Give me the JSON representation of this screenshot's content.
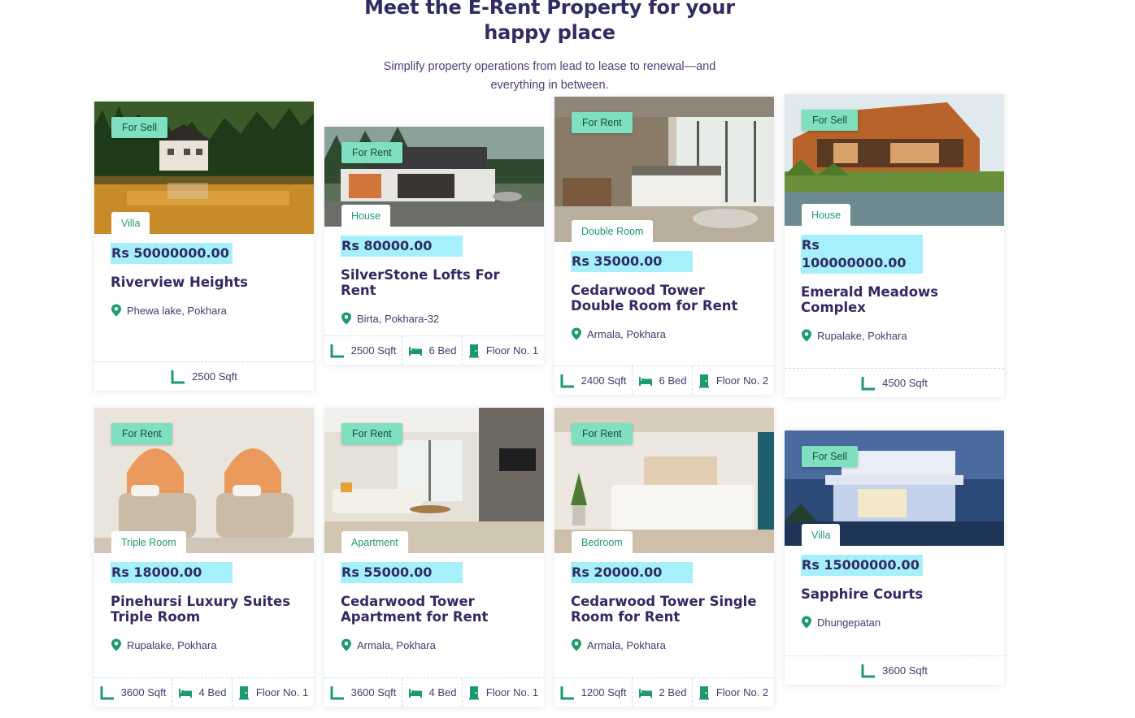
{
  "header": {
    "title_line1": "Meet the E-Rent Property for your",
    "title_line2": "happy place",
    "subtitle_line1": "Simplify property operations from lead to lease to renewal—and",
    "subtitle_line2": "everything in between."
  },
  "colors": {
    "accent": "#7fe0c0",
    "price_bg": "#a6f0fb",
    "heading": "#2f2c63",
    "green": "#1d9a6c"
  },
  "listings": [
    {
      "status": "For Sell",
      "type": "Villa",
      "price": "Rs 50000000.00",
      "title": "Riverview Heights",
      "location": "Phewa lake, Pokhara",
      "area": "2500 Sqft"
    },
    {
      "status": "For Rent",
      "type": "House",
      "price": "Rs 80000.00",
      "title": "SilverStone Lofts For Rent",
      "location": "Birta, Pokhara-32",
      "area": "2500 Sqft",
      "beds": "6 Bed",
      "floor": "Floor No. 1"
    },
    {
      "status": "For Rent",
      "type": "Double Room",
      "price": "Rs 35000.00",
      "title": "Cedarwood Tower Double Room for Rent",
      "location": "Armala, Pokhara",
      "area": "2400 Sqft",
      "beds": "6 Bed",
      "floor": "Floor No. 2"
    },
    {
      "status": "For Sell",
      "type": "House",
      "price": "Rs 100000000.00",
      "title": "Emerald Meadows Complex",
      "location": "Rupalake, Pokhara",
      "area": "4500 Sqft"
    },
    {
      "status": "For Rent",
      "type": "Triple Room",
      "price": "Rs 18000.00",
      "title": "Pinehursi Luxury Suites Triple Room",
      "location": "Rupalake, Pokhara",
      "area": "3600 Sqft",
      "beds": "4 Bed",
      "floor": "Floor No. 1"
    },
    {
      "status": "For Rent",
      "type": "Apartment",
      "price": "Rs 55000.00",
      "title": "Cedarwood Tower Apartment for Rent",
      "location": "Armala, Pokhara",
      "area": "3600 Sqft",
      "beds": "4 Bed",
      "floor": "Floor No. 1"
    },
    {
      "status": "For Rent",
      "type": "Bedroom",
      "price": "Rs 20000.00",
      "title": "Cedarwood Tower Single Room for Rent",
      "location": "Armala, Pokhara",
      "area": "1200 Sqft",
      "beds": "2 Bed",
      "floor": "Floor No. 2"
    },
    {
      "status": "For Sell",
      "type": "Villa",
      "price": "Rs 15000000.00",
      "title": "Sapphire Courts",
      "location": "Dhungepatan",
      "area": "3600 Sqft"
    }
  ]
}
